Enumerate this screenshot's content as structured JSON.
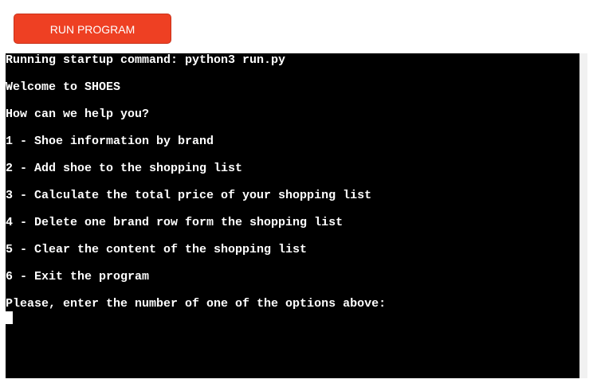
{
  "toolbar": {
    "run_label": "RUN PROGRAM"
  },
  "terminal": {
    "lines": [
      "Running startup command: python3 run.py",
      "Welcome to SHOES",
      "How can we help you?",
      "1 - Shoe information by brand",
      "2 - Add shoe to the shopping list",
      "3 - Calculate the total price of your shopping list",
      "4 - Delete one brand row form the shopping list",
      "5 - Clear the content of the shopping list",
      "6 - Exit the program",
      "Please, enter the number of one of the options above:"
    ]
  },
  "colors": {
    "run_button": "#ee4023",
    "terminal_bg": "#000000",
    "terminal_text": "#ffffff"
  }
}
